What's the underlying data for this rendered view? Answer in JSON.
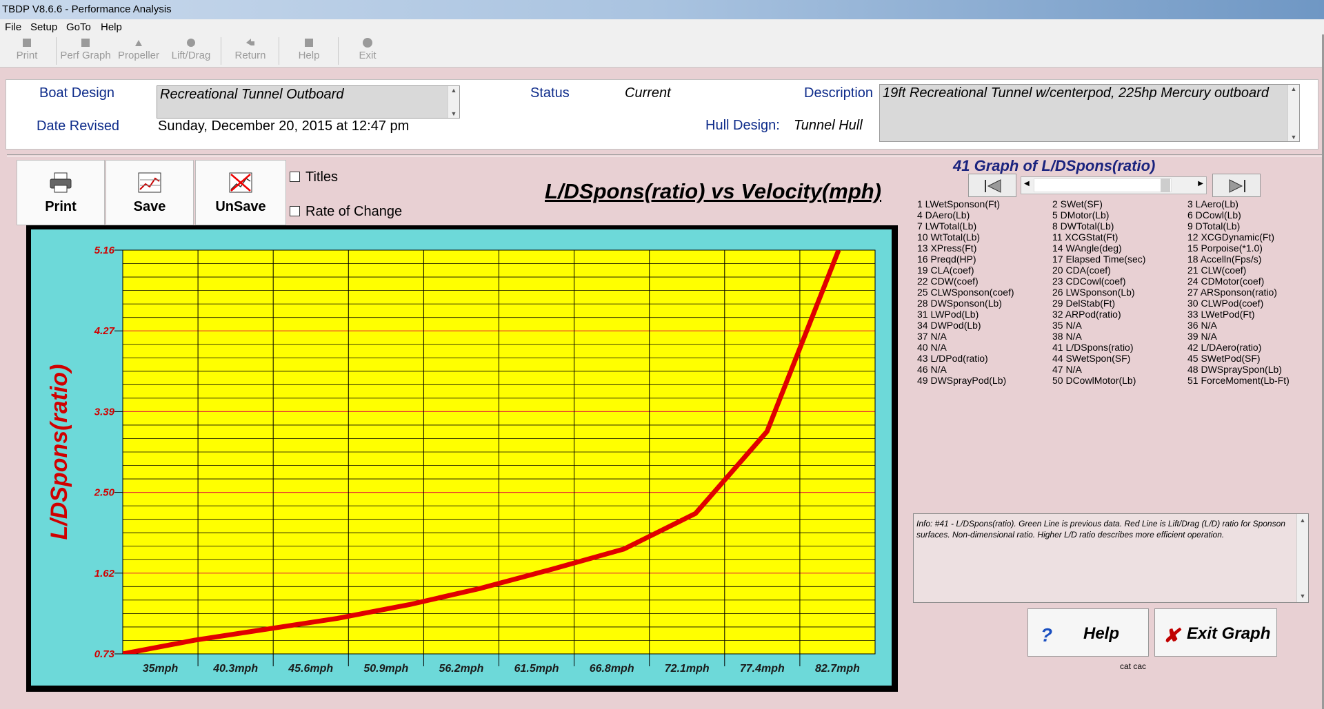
{
  "window": {
    "title": "TBDP V8.6.6 - Performance Analysis"
  },
  "menu": [
    "File",
    "Setup",
    "GoTo",
    "Help"
  ],
  "toolbar": [
    {
      "label": "Print",
      "icon": "printer-icon"
    },
    {
      "label": "Perf Graph",
      "icon": "graph-icon"
    },
    {
      "label": "Propeller",
      "icon": "propeller-icon"
    },
    {
      "label": "Lift/Drag",
      "icon": "liftdrag-icon"
    },
    {
      "label": "Return",
      "icon": "return-icon"
    },
    {
      "label": "Help",
      "icon": "help-icon"
    },
    {
      "label": "Exit",
      "icon": "exit-icon"
    }
  ],
  "header": {
    "boat_design_label": "Boat Design",
    "boat_design": "Recreational Tunnel Outboard",
    "date_revised_label": "Date Revised",
    "date_revised": "Sunday, December 20, 2015 at 12:47 pm",
    "status_label": "Status",
    "status": "Current",
    "hull_design_label": "Hull Design:",
    "hull_design": "Tunnel Hull",
    "description_label": "Description",
    "description": "19ft Recreational Tunnel w/centerpod, 225hp Mercury outboard"
  },
  "buttons": {
    "print": "Print",
    "save": "Save",
    "unsave": "UnSave"
  },
  "options": {
    "titles": "Titles",
    "rate_of_change": "Rate of Change",
    "titles_checked": false,
    "rate_checked": false
  },
  "graph_title": "L/DSpons(ratio) vs Velocity(mph)",
  "graph_selector_title": "41 Graph of L/DSpons(ratio)",
  "variables": [
    [
      "1 LWetSponson(Ft)",
      "2 SWet(SF)",
      "3 LAero(Lb)"
    ],
    [
      "4 DAero(Lb)",
      "5 DMotor(Lb)",
      "6 DCowl(Lb)"
    ],
    [
      "7 LWTotal(Lb)",
      "8 DWTotal(Lb)",
      "9 DTotal(Lb)"
    ],
    [
      "10 WtTotal(Lb)",
      "11 XCGStat(Ft)",
      "12 XCGDynamic(Ft)"
    ],
    [
      "13 XPress(Ft)",
      "14 WAngle(deg)",
      "15 Porpoise(*1.0)"
    ],
    [
      "16 Preqd(HP)",
      "17 Elapsed Time(sec)",
      "18 Accelln(Fps/s)"
    ],
    [
      "19 CLA(coef)",
      "20 CDA(coef)",
      "21 CLW(coef)"
    ],
    [
      "22 CDW(coef)",
      "23 CDCowl(coef)",
      "24 CDMotor(coef)"
    ],
    [
      "25 CLWSponson(coef)",
      "26 LWSponson(Lb)",
      "27 ARSponson(ratio)"
    ],
    [
      "28 DWSponson(Lb)",
      "29 DelStab(Ft)",
      "30 CLWPod(coef)"
    ],
    [
      "31 LWPod(Lb)",
      "32 ARPod(ratio)",
      "33 LWetPod(Ft)"
    ],
    [
      "34 DWPod(Lb)",
      "35 N/A",
      "36 N/A"
    ],
    [
      "37 N/A",
      "38 N/A",
      "39 N/A"
    ],
    [
      "40 N/A",
      "41 L/DSpons(ratio)",
      "42 L/DAero(ratio)"
    ],
    [
      "43 L/DPod(ratio)",
      "44 SWetSpon(SF)",
      "45 SWetPod(SF)"
    ],
    [
      "46 N/A",
      "47 N/A",
      "48 DWSpraySpon(Lb)"
    ],
    [
      "49 DWSprayPod(Lb)",
      "50 DCowlMotor(Lb)",
      "51 ForceMoment(Lb-Ft)"
    ]
  ],
  "info": "Info: #41 - L/DSpons(ratio). Green Line is previous data. Red Line is Lift/Drag (L/D) ratio for Sponson surfaces.  Non-dimensional ratio.  Higher L/D ratio describes more efficient operation.",
  "bottom": {
    "help": "Help",
    "exit": "Exit Graph",
    "footer": "cat cac"
  },
  "colors": {
    "plot_bg": "#ffff00",
    "frame_bg": "#6dd9d9",
    "line": "#e00000",
    "label": "#d00000",
    "grid_major": "#e83030",
    "grid_minor": "#000000"
  },
  "chart_data": {
    "type": "line",
    "title": "L/DSpons(ratio) vs Velocity(mph)",
    "xlabel": "",
    "ylabel": "L/DSpons(ratio)",
    "x_tick_labels": [
      "35mph",
      "40.3mph",
      "45.6mph",
      "50.9mph",
      "56.2mph",
      "61.5mph",
      "66.8mph",
      "72.1mph",
      "77.4mph",
      "82.7mph"
    ],
    "y_tick_labels": [
      "5.16",
      "4.27",
      "3.39",
      "2.50",
      "1.62",
      "0.73"
    ],
    "ylim": [
      0.73,
      5.16
    ],
    "xlim": [
      35,
      90.7
    ],
    "series": [
      {
        "x": [
          35,
          40.3,
          45.6,
          50.9,
          56.2,
          61.5,
          66.8,
          72.1,
          77.4,
          82.7,
          88.0
        ],
        "values": [
          0.73,
          0.88,
          1.0,
          1.12,
          1.27,
          1.45,
          1.66,
          1.88,
          2.27,
          3.17,
          5.16
        ]
      }
    ],
    "grid": true
  }
}
